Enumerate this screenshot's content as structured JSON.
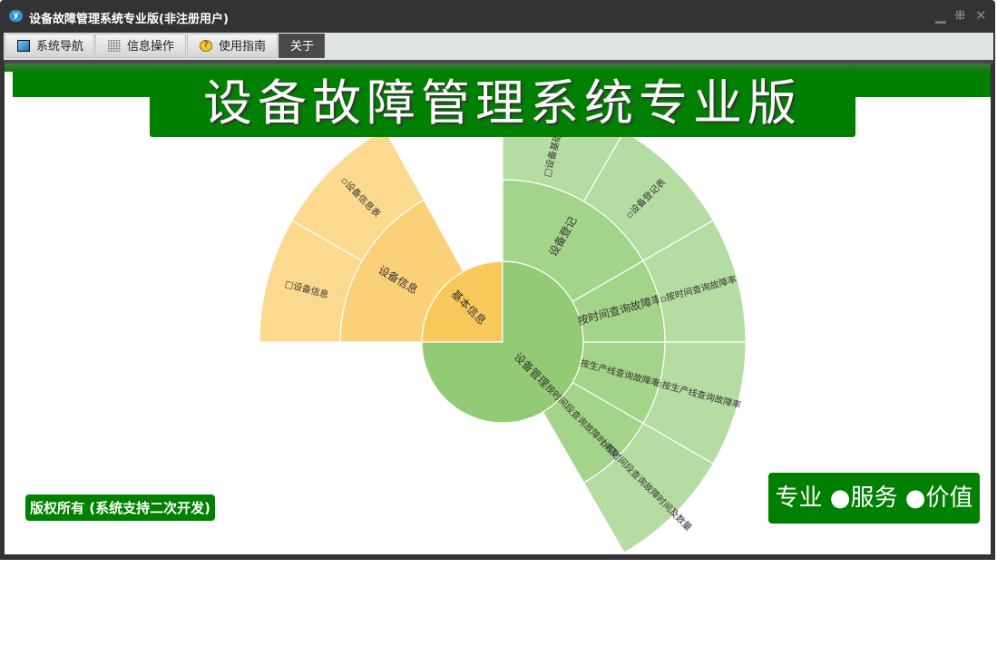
{
  "window": {
    "title": "设备故障管理系统专业版(非注册用户)",
    "logo": "y"
  },
  "tabs": [
    {
      "label": "系统导航",
      "icon": "monitor-icon"
    },
    {
      "label": "信息操作",
      "icon": "grid-icon"
    },
    {
      "label": "使用指南",
      "icon": "help-icon"
    },
    {
      "label": "关于",
      "active": true
    }
  ],
  "banner": {
    "title": "设备故障管理系统专业版"
  },
  "footer": {
    "copyright": "版权所有 (系统支持二次开发)",
    "slogan": "专业 ●服务 ●价值"
  },
  "colors": {
    "green": "#008000",
    "orange1": "#F9C85A",
    "orange2": "#FAD179",
    "orange3": "#FBD98E",
    "green1": "#93CB74",
    "green2": "#A3D48A",
    "green3": "#B5DCA3"
  },
  "chart_data": {
    "type": "sunburst",
    "rings": [
      [
        {
          "label": "基本信息",
          "start": 270,
          "end": 360,
          "color": "orange1"
        },
        {
          "label": "设备管理",
          "start": 0,
          "end": 270,
          "color": "green1"
        }
      ],
      [
        {
          "label": "设备信息",
          "start": 270,
          "end": 331,
          "color": "orange2"
        },
        {
          "label": "设备登记",
          "start": 0,
          "end": 60,
          "color": "green2"
        },
        {
          "label": "按时间查询故障率",
          "start": 60,
          "end": 90,
          "color": "green2"
        },
        {
          "label": "按生产线查询故障率",
          "start": 90,
          "end": 120,
          "color": "green2"
        },
        {
          "label": "按时间段查询故障时间及数量",
          "start": 120,
          "end": 150,
          "color": "green2"
        }
      ],
      [
        {
          "label": "□设备信息",
          "start": 270,
          "end": 300,
          "color": "orange3"
        },
        {
          "label": "▫设备信息表",
          "start": 300,
          "end": 331,
          "color": "orange3"
        },
        {
          "label": "□设备基础信息",
          "start": 0,
          "end": 30,
          "color": "green3"
        },
        {
          "label": "▫设备登记表",
          "start": 30,
          "end": 60,
          "color": "green3"
        },
        {
          "label": "▫按时间查询故障率",
          "start": 60,
          "end": 90,
          "color": "green3"
        },
        {
          "label": "▫按生产线查询故障率",
          "start": 90,
          "end": 120,
          "color": "green3"
        },
        {
          "label": "▫按时间段查询故障时间及数量",
          "start": 120,
          "end": 150,
          "color": "green3"
        }
      ]
    ]
  }
}
